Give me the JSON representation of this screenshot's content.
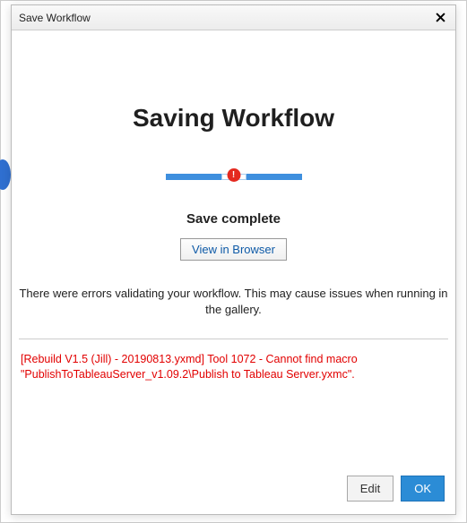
{
  "titlebar": {
    "title": "Save Workflow"
  },
  "main": {
    "heading": "Saving Workflow",
    "status": "Save complete",
    "view_button": "View in Browser",
    "warning": "There were errors validating your workflow. This may cause issues when running in the gallery.",
    "error_message": "[Rebuild V1.5 (Jill) - 20190813.yxmd] Tool 1072 - Cannot find macro \"PublishToTableauServer_v1.09.2\\Publish to Tableau Server.yxmc\"."
  },
  "footer": {
    "edit": "Edit",
    "ok": "OK"
  }
}
